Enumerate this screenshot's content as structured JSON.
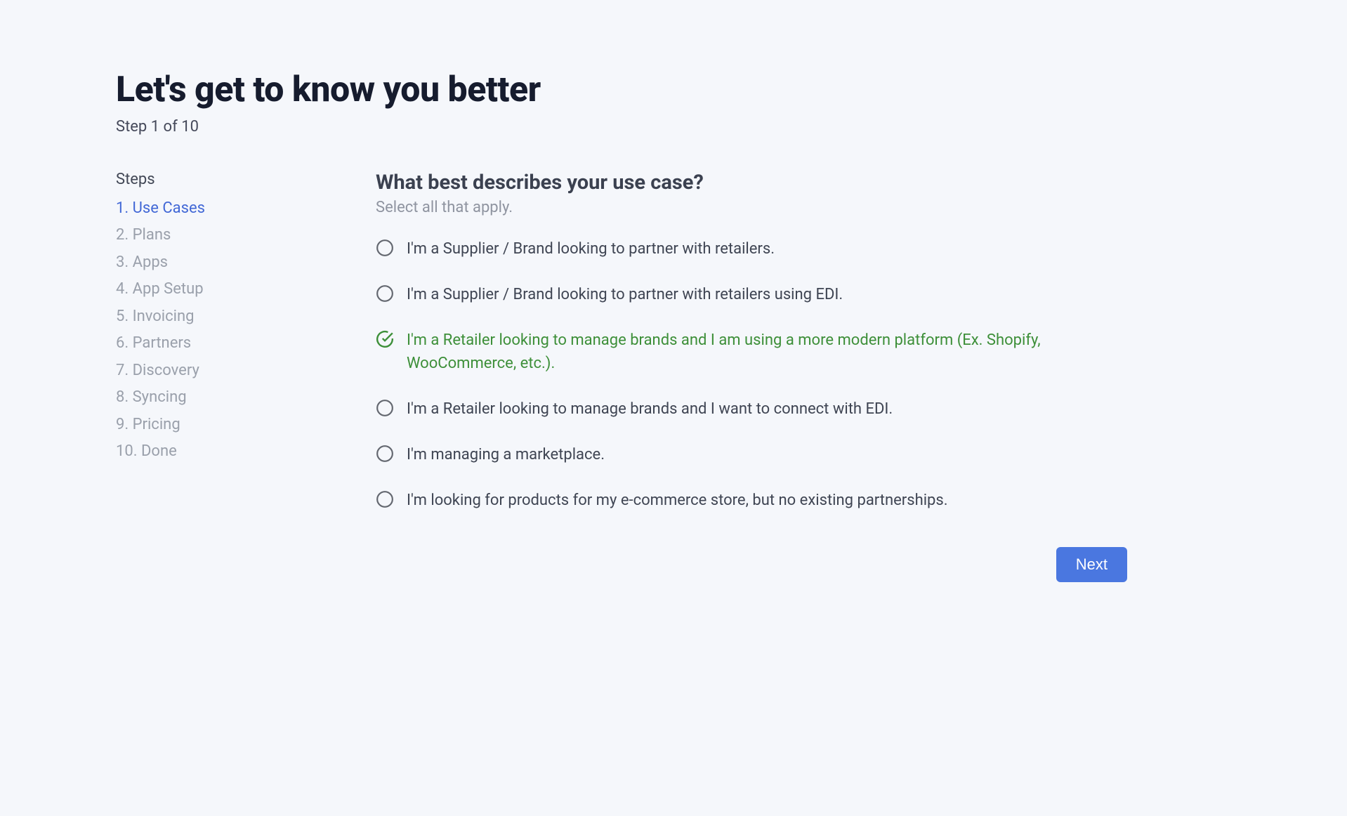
{
  "header": {
    "title": "Let's get to know you better",
    "step_indicator": "Step 1 of 10"
  },
  "sidebar": {
    "heading": "Steps",
    "steps": [
      {
        "label": "1. Use Cases",
        "active": true
      },
      {
        "label": "2. Plans",
        "active": false
      },
      {
        "label": "3. Apps",
        "active": false
      },
      {
        "label": "4. App Setup",
        "active": false
      },
      {
        "label": "5. Invoicing",
        "active": false
      },
      {
        "label": "6. Partners",
        "active": false
      },
      {
        "label": "7. Discovery",
        "active": false
      },
      {
        "label": "8. Syncing",
        "active": false
      },
      {
        "label": "9. Pricing",
        "active": false
      },
      {
        "label": "10. Done",
        "active": false
      }
    ]
  },
  "main": {
    "question_title": "What best describes your use case?",
    "question_subtitle": "Select all that apply.",
    "options": [
      {
        "label": "I'm a Supplier / Brand looking to partner with retailers.",
        "selected": false
      },
      {
        "label": "I'm a Supplier / Brand looking to partner with retailers using EDI.",
        "selected": false
      },
      {
        "label": "I'm a Retailer looking to manage brands and I am using a more modern platform (Ex. Shopify, WooCommerce, etc.).",
        "selected": true
      },
      {
        "label": "I'm a Retailer looking to manage brands and I want to connect with EDI.",
        "selected": false
      },
      {
        "label": "I'm managing a marketplace.",
        "selected": false
      },
      {
        "label": "I'm looking for products for my e-commerce store, but no existing partnerships.",
        "selected": false
      }
    ]
  },
  "footer": {
    "next_label": "Next"
  }
}
